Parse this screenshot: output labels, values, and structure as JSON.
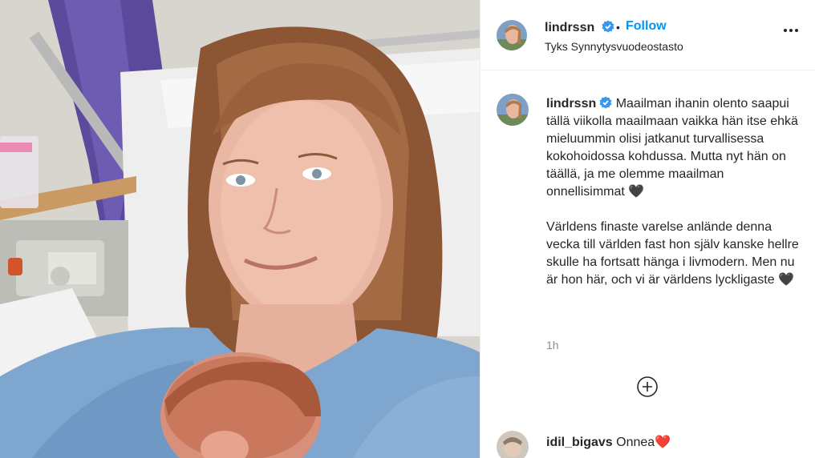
{
  "post": {
    "username": "lindrssn",
    "follow_label": "Follow",
    "separator": "•",
    "location": "Tyks Synnytysvuodeostasto"
  },
  "caption": {
    "username": "lindrssn",
    "finnish": "Maailman ihanin olento saapui tällä viikolla maailmaan vaikka hän itse ehkä mieluummin olisi jatkanut turvallisessa kokohoidossa kohdussa. Mutta nyt hän on täällä, ja me olemme maailman onnellisimmat 🖤",
    "swedish": "Världens finaste varelse anlände denna vecka till världen fast hon själv kanske hellre skulle ha fortsatt hänga i livmodern. Men nu är hon här, och vi är världens lyckligaste 🖤",
    "time": "1h"
  },
  "reply": {
    "username": "idil_bigavs",
    "text": "Onnea❤️"
  },
  "icons": {
    "verified": "verified-badge-icon",
    "more": "more-options-icon",
    "load_more": "plus-circle-icon"
  },
  "colors": {
    "accent": "#0095f6",
    "verified": "#3897f0",
    "text": "#262626",
    "muted": "#8e8e8e",
    "border": "#efefef"
  }
}
